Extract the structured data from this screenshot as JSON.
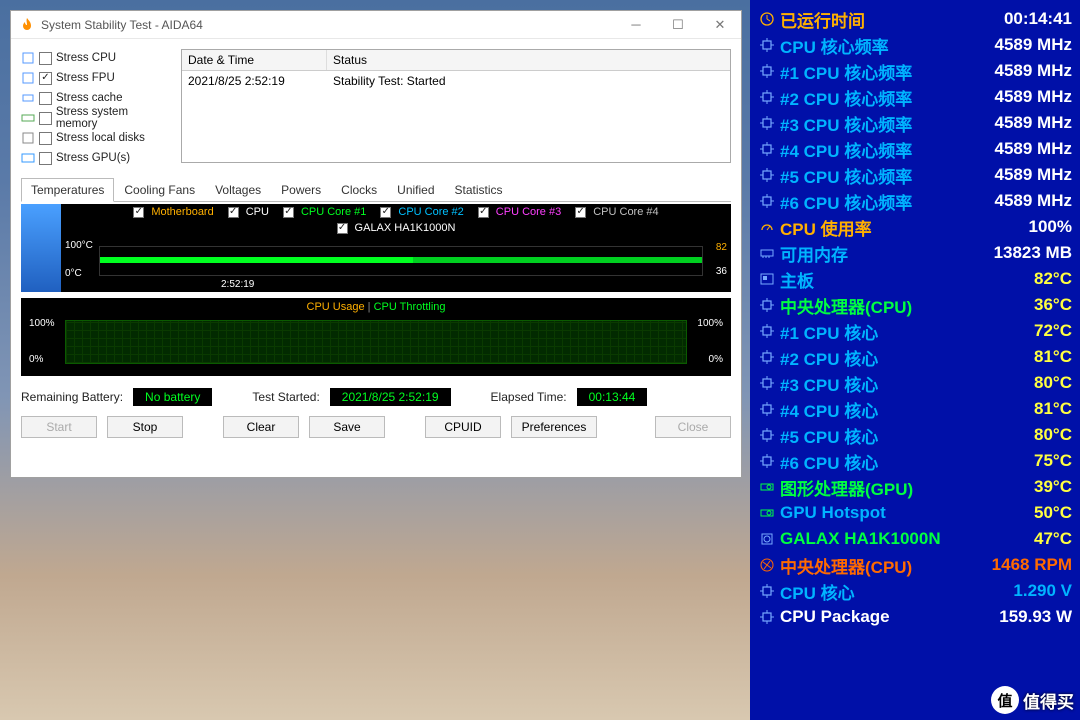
{
  "window": {
    "title": "System Stability Test - AIDA64",
    "stress_options": [
      {
        "id": "cpu",
        "label": "Stress CPU",
        "checked": false
      },
      {
        "id": "fpu",
        "label": "Stress FPU",
        "checked": true
      },
      {
        "id": "cache",
        "label": "Stress cache",
        "checked": false
      },
      {
        "id": "mem",
        "label": "Stress system memory",
        "checked": false
      },
      {
        "id": "disk",
        "label": "Stress local disks",
        "checked": false
      },
      {
        "id": "gpu",
        "label": "Stress GPU(s)",
        "checked": false
      }
    ],
    "log": {
      "col1": "Date & Time",
      "col2": "Status",
      "row1_time": "2021/8/25 2:52:19",
      "row1_status": "Stability Test: Started"
    },
    "tabs": [
      "Temperatures",
      "Cooling Fans",
      "Voltages",
      "Powers",
      "Clocks",
      "Unified",
      "Statistics"
    ],
    "active_tab": 0,
    "temp_chart": {
      "legend": [
        {
          "label": "Motherboard",
          "color": "#ffb000"
        },
        {
          "label": "CPU",
          "color": "#ffffff"
        },
        {
          "label": "CPU Core #1",
          "color": "#00ff20"
        },
        {
          "label": "CPU Core #2",
          "color": "#00c0ff"
        },
        {
          "label": "CPU Core #3",
          "color": "#ff40ff"
        },
        {
          "label": "CPU Core #4",
          "color": "#c0c0c0"
        }
      ],
      "legend2": [
        {
          "label": "GALAX HA1K1000N",
          "color": "#ffffff"
        }
      ],
      "y_top": "100°C",
      "y_bot": "0°C",
      "r_top": "82",
      "r_bot": "36",
      "x_label": "2:52:19"
    },
    "usage_chart": {
      "title1": "CPU Usage",
      "title2": "CPU Throttling",
      "y_top": "100%",
      "y_bot": "0%",
      "r_top": "100%",
      "r_bot": "0%"
    },
    "status": {
      "batt_label": "Remaining Battery:",
      "batt_value": "No battery",
      "start_label": "Test Started:",
      "start_value": "2021/8/25 2:52:19",
      "elapsed_label": "Elapsed Time:",
      "elapsed_value": "00:13:44"
    },
    "buttons": {
      "start": "Start",
      "stop": "Stop",
      "clear": "Clear",
      "save": "Save",
      "cpuid": "CPUID",
      "prefs": "Preferences",
      "close": "Close"
    }
  },
  "osd": [
    {
      "icon": "clock",
      "label": "已运行时间",
      "value": "00:14:41",
      "lcol": "#ffb000",
      "vcol": "#ffffff"
    },
    {
      "icon": "chip",
      "label": "CPU 核心频率",
      "value": "4589 MHz",
      "lcol": "#00b4ff",
      "vcol": "#ffffff"
    },
    {
      "icon": "chip",
      "label": "#1 CPU 核心频率",
      "value": "4589 MHz",
      "lcol": "#00b4ff",
      "vcol": "#ffffff"
    },
    {
      "icon": "chip",
      "label": "#2 CPU 核心频率",
      "value": "4589 MHz",
      "lcol": "#00b4ff",
      "vcol": "#ffffff"
    },
    {
      "icon": "chip",
      "label": "#3 CPU 核心频率",
      "value": "4589 MHz",
      "lcol": "#00b4ff",
      "vcol": "#ffffff"
    },
    {
      "icon": "chip",
      "label": "#4 CPU 核心频率",
      "value": "4589 MHz",
      "lcol": "#00b4ff",
      "vcol": "#ffffff"
    },
    {
      "icon": "chip",
      "label": "#5 CPU 核心频率",
      "value": "4589 MHz",
      "lcol": "#00b4ff",
      "vcol": "#ffffff"
    },
    {
      "icon": "chip",
      "label": "#6 CPU 核心频率",
      "value": "4589 MHz",
      "lcol": "#00b4ff",
      "vcol": "#ffffff"
    },
    {
      "icon": "gauge",
      "label": "CPU 使用率",
      "value": "100%",
      "lcol": "#ffb000",
      "vcol": "#ffffff"
    },
    {
      "icon": "mem",
      "label": "可用内存",
      "value": "13823 MB",
      "lcol": "#00b4ff",
      "vcol": "#ffffff"
    },
    {
      "icon": "board",
      "label": "主板",
      "value": "82°C",
      "lcol": "#00b4ff",
      "vcol": "#ffff40"
    },
    {
      "icon": "chip",
      "label": "中央处理器(CPU)",
      "value": "36°C",
      "lcol": "#00ff40",
      "vcol": "#ffff40"
    },
    {
      "icon": "chip",
      "label": " #1 CPU 核心",
      "value": "72°C",
      "lcol": "#00b4ff",
      "vcol": "#ffff40"
    },
    {
      "icon": "chip",
      "label": " #2 CPU 核心",
      "value": "81°C",
      "lcol": "#00b4ff",
      "vcol": "#ffff40"
    },
    {
      "icon": "chip",
      "label": " #3 CPU 核心",
      "value": "80°C",
      "lcol": "#00b4ff",
      "vcol": "#ffff40"
    },
    {
      "icon": "chip",
      "label": " #4 CPU 核心",
      "value": "81°C",
      "lcol": "#00b4ff",
      "vcol": "#ffff40"
    },
    {
      "icon": "chip",
      "label": " #5 CPU 核心",
      "value": "80°C",
      "lcol": "#00b4ff",
      "vcol": "#ffff40"
    },
    {
      "icon": "chip",
      "label": " #6 CPU 核心",
      "value": "75°C",
      "lcol": "#00b4ff",
      "vcol": "#ffff40"
    },
    {
      "icon": "gpu",
      "label": "图形处理器(GPU)",
      "value": "39°C",
      "lcol": "#00ff40",
      "vcol": "#ffff40"
    },
    {
      "icon": "gpu",
      "label": "GPU Hotspot",
      "value": "50°C",
      "lcol": "#00b4ff",
      "vcol": "#ffff40"
    },
    {
      "icon": "disk",
      "label": "GALAX HA1K1000N",
      "value": "47°C",
      "lcol": "#00ff40",
      "vcol": "#ffff40"
    },
    {
      "icon": "fan",
      "label": "中央处理器(CPU)",
      "value": "1468 RPM",
      "lcol": "#ff6a00",
      "vcol": "#ff6a00"
    },
    {
      "icon": "chip",
      "label": "CPU 核心",
      "value": "1.290 V",
      "lcol": "#00b4ff",
      "vcol": "#00b4ff"
    },
    {
      "icon": "chip",
      "label": "CPU Package",
      "value": "159.93 W",
      "lcol": "#ffffff",
      "vcol": "#ffffff"
    }
  ],
  "watermark": {
    "badge": "值",
    "text": "值得买"
  },
  "chart_data": {
    "type": "line",
    "title": "Temperatures",
    "ylim": [
      0,
      100
    ],
    "x": [
      "2:52:19"
    ],
    "series": [
      {
        "name": "Motherboard",
        "value": 82
      },
      {
        "name": "CPU",
        "value": 36
      },
      {
        "name": "CPU Core #1",
        "value": 72
      },
      {
        "name": "CPU Core #2",
        "value": 81
      },
      {
        "name": "CPU Core #3",
        "value": 80
      },
      {
        "name": "CPU Core #4",
        "value": 81
      },
      {
        "name": "GALAX HA1K1000N",
        "value": 47
      }
    ],
    "secondary": {
      "type": "line",
      "title": "CPU Usage / CPU Throttling",
      "ylim": [
        0,
        100
      ],
      "series": [
        {
          "name": "CPU Usage",
          "value": 100
        },
        {
          "name": "CPU Throttling",
          "value": 0
        }
      ]
    }
  }
}
